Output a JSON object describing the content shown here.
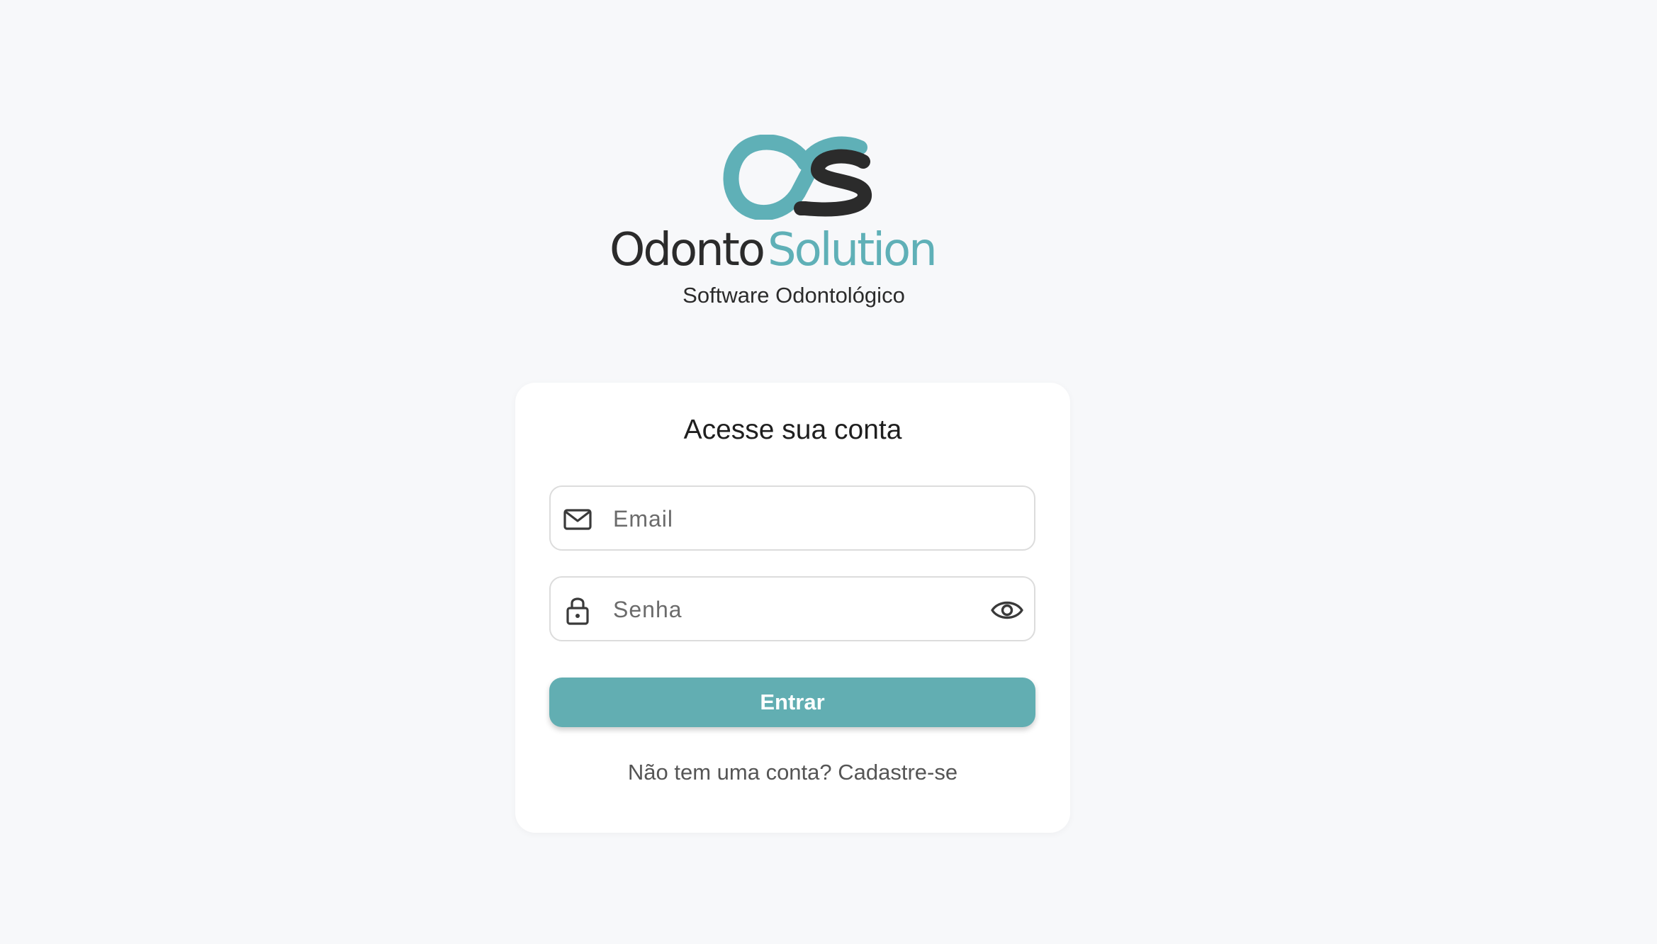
{
  "logo": {
    "word_primary": "Odonto",
    "word_secondary": "Solution",
    "tagline": "Software Odontológico",
    "colors": {
      "dark": "#2b2b2b",
      "teal": "#5fb0b7"
    }
  },
  "login": {
    "title": "Acesse sua conta",
    "email_placeholder": "Email",
    "email_value": "",
    "password_placeholder": "Senha",
    "password_value": "",
    "submit_label": "Entrar",
    "signup_prompt": "Não tem uma conta?",
    "signup_link": "Cadastre-se"
  },
  "icons": {
    "email": "mail-icon",
    "password": "lock-icon",
    "toggle_password": "eye-icon"
  },
  "colors": {
    "background": "#f7f8fa",
    "card": "#ffffff",
    "accent": "#62aeb2",
    "text": "#1f1f1f",
    "muted": "#555555"
  }
}
